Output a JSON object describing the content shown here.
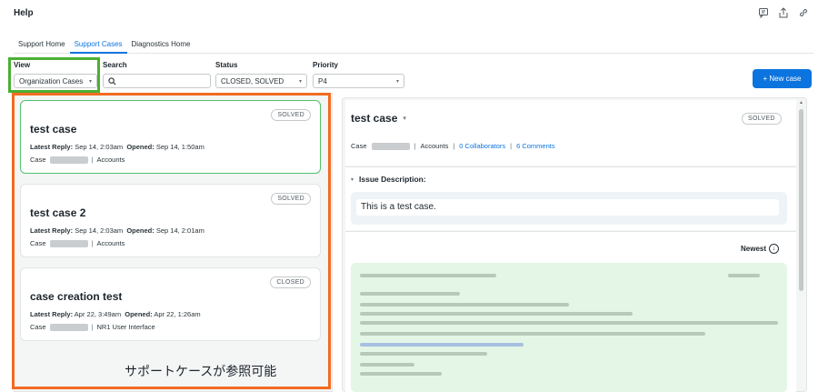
{
  "app": {
    "title": "Help"
  },
  "top_icons": [
    "feedback-icon",
    "share-icon",
    "link-icon"
  ],
  "tabs": [
    {
      "label": "Support Home",
      "active": false
    },
    {
      "label": "Support Cases",
      "active": true
    },
    {
      "label": "Diagnostics Home",
      "active": false
    }
  ],
  "filters": {
    "view": {
      "label": "View",
      "value": "Organization Cases"
    },
    "search": {
      "label": "Search",
      "value": "",
      "placeholder": ""
    },
    "status": {
      "label": "Status",
      "value": "CLOSED, SOLVED"
    },
    "priority": {
      "label": "Priority",
      "value": "P4"
    }
  },
  "new_case_button": "+ New case",
  "case_labels": {
    "latest_reply": "Latest Reply:",
    "opened": "Opened:",
    "case": "Case",
    "separator": "|"
  },
  "cases": [
    {
      "title": "test case",
      "status": "SOLVED",
      "latest_reply": "Sep 14, 2:03am",
      "opened": "Sep 14, 1:50am",
      "component": "Accounts"
    },
    {
      "title": "test case 2",
      "status": "SOLVED",
      "latest_reply": "Sep 14, 2:03am",
      "opened": "Sep 14, 2:01am",
      "component": "Accounts"
    },
    {
      "title": "case creation test",
      "status": "CLOSED",
      "latest_reply": "Apr 22, 3:49am",
      "opened": "Apr 22, 1:26am",
      "component": "NR1 User Interface"
    }
  ],
  "caption": "サポートケースが参照可能",
  "detail": {
    "title": "test case",
    "status": "SOLVED",
    "case_label": "Case",
    "component": "Accounts",
    "collaborators": "0 Collaborators",
    "comments": "6 Comments",
    "issue_heading": "Issue Description:",
    "issue_text": "This is a test case.",
    "sort_label": "Newest"
  },
  "colors": {
    "accent": "#0c74df",
    "view_highlight": "#4caf32",
    "cases_highlight": "#f26b21",
    "selected_card_border": "#53c26b",
    "reply_background": "#e4f6e6"
  }
}
